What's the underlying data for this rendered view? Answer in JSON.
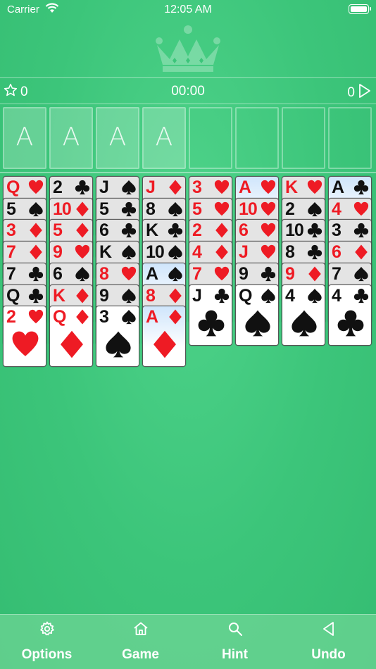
{
  "status_bar": {
    "carrier": "Carrier",
    "time": "12:05 AM"
  },
  "hud": {
    "stars": "0",
    "timer": "00:00",
    "moves": "0"
  },
  "foundations": [
    "A",
    "A",
    "A",
    "A"
  ],
  "free_cells": [
    "",
    "",
    "",
    ""
  ],
  "tableau": [
    [
      {
        "rank": "Q",
        "suit": "heart",
        "color": "red"
      },
      {
        "rank": "5",
        "suit": "spade",
        "color": "black"
      },
      {
        "rank": "3",
        "suit": "diamond",
        "color": "red"
      },
      {
        "rank": "7",
        "suit": "diamond",
        "color": "red"
      },
      {
        "rank": "7",
        "suit": "club",
        "color": "black"
      },
      {
        "rank": "Q",
        "suit": "club",
        "color": "black"
      },
      {
        "rank": "2",
        "suit": "heart",
        "color": "red"
      }
    ],
    [
      {
        "rank": "2",
        "suit": "club",
        "color": "black"
      },
      {
        "rank": "10",
        "suit": "diamond",
        "color": "red"
      },
      {
        "rank": "5",
        "suit": "diamond",
        "color": "red"
      },
      {
        "rank": "9",
        "suit": "heart",
        "color": "red"
      },
      {
        "rank": "6",
        "suit": "spade",
        "color": "black"
      },
      {
        "rank": "K",
        "suit": "diamond",
        "color": "red"
      },
      {
        "rank": "Q",
        "suit": "diamond",
        "color": "red"
      }
    ],
    [
      {
        "rank": "J",
        "suit": "spade",
        "color": "black"
      },
      {
        "rank": "5",
        "suit": "club",
        "color": "black"
      },
      {
        "rank": "6",
        "suit": "club",
        "color": "black"
      },
      {
        "rank": "K",
        "suit": "spade",
        "color": "black"
      },
      {
        "rank": "8",
        "suit": "heart",
        "color": "red"
      },
      {
        "rank": "9",
        "suit": "spade",
        "color": "black"
      },
      {
        "rank": "3",
        "suit": "spade",
        "color": "black"
      }
    ],
    [
      {
        "rank": "J",
        "suit": "diamond",
        "color": "red"
      },
      {
        "rank": "8",
        "suit": "spade",
        "color": "black"
      },
      {
        "rank": "K",
        "suit": "club",
        "color": "black"
      },
      {
        "rank": "10",
        "suit": "spade",
        "color": "black"
      },
      {
        "rank": "A",
        "suit": "spade",
        "color": "black",
        "highlight": true
      },
      {
        "rank": "8",
        "suit": "diamond",
        "color": "red"
      },
      {
        "rank": "A",
        "suit": "diamond",
        "color": "red",
        "highlight": true
      }
    ],
    [
      {
        "rank": "3",
        "suit": "heart",
        "color": "red"
      },
      {
        "rank": "5",
        "suit": "heart",
        "color": "red"
      },
      {
        "rank": "2",
        "suit": "diamond",
        "color": "red"
      },
      {
        "rank": "4",
        "suit": "diamond",
        "color": "red"
      },
      {
        "rank": "7",
        "suit": "heart",
        "color": "red"
      },
      {
        "rank": "J",
        "suit": "club",
        "color": "black"
      }
    ],
    [
      {
        "rank": "A",
        "suit": "heart",
        "color": "red",
        "highlight": true
      },
      {
        "rank": "10",
        "suit": "heart",
        "color": "red"
      },
      {
        "rank": "6",
        "suit": "heart",
        "color": "red"
      },
      {
        "rank": "J",
        "suit": "heart",
        "color": "red"
      },
      {
        "rank": "9",
        "suit": "club",
        "color": "black"
      },
      {
        "rank": "Q",
        "suit": "spade",
        "color": "black"
      }
    ],
    [
      {
        "rank": "K",
        "suit": "heart",
        "color": "red"
      },
      {
        "rank": "2",
        "suit": "spade",
        "color": "black"
      },
      {
        "rank": "10",
        "suit": "club",
        "color": "black"
      },
      {
        "rank": "8",
        "suit": "club",
        "color": "black"
      },
      {
        "rank": "9",
        "suit": "diamond",
        "color": "red"
      },
      {
        "rank": "4",
        "suit": "spade",
        "color": "black"
      }
    ],
    [
      {
        "rank": "A",
        "suit": "club",
        "color": "black",
        "highlight": true
      },
      {
        "rank": "4",
        "suit": "heart",
        "color": "red"
      },
      {
        "rank": "3",
        "suit": "club",
        "color": "black"
      },
      {
        "rank": "6",
        "suit": "diamond",
        "color": "red"
      },
      {
        "rank": "7",
        "suit": "spade",
        "color": "black"
      },
      {
        "rank": "4",
        "suit": "club",
        "color": "black"
      }
    ]
  ],
  "toolbar": {
    "options_label": "Options",
    "game_label": "Game",
    "hint_label": "Hint",
    "undo_label": "Undo"
  },
  "icons": {
    "options": "gear-icon",
    "game": "home-icon",
    "hint": "magnifier-icon",
    "undo": "triangle-left-icon"
  },
  "colors": {
    "felt": "#3cc57a",
    "red_suit": "#ee1b24",
    "black_suit": "#111111",
    "highlight_card": "#cfe5fb"
  }
}
